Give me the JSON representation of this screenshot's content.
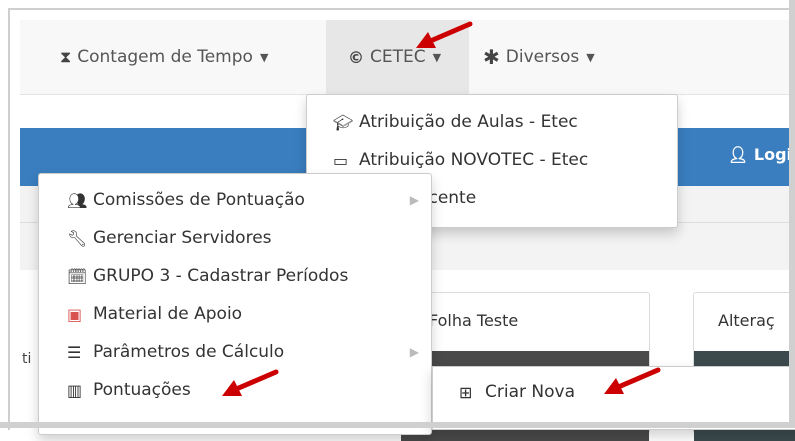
{
  "navbar": {
    "items": [
      {
        "label": "Contagem de Tempo",
        "icon": "hourglass-icon"
      },
      {
        "label": "CETEC",
        "icon": "copyright-icon"
      },
      {
        "label": "Diversos",
        "icon": "asterisk-icon"
      }
    ],
    "login_label": "Logi"
  },
  "cetec_menu": {
    "items": [
      {
        "label": "Atribuição de Aulas - Etec",
        "icon": "graduation-cap-icon"
      },
      {
        "label": "Atribuição NOVOTEC - Etec",
        "icon": "presentation-icon"
      },
      {
        "label": "ação Docente"
      }
    ]
  },
  "left_menu": {
    "items": [
      {
        "label": "Comissões de Pontuação",
        "icon": "users-icon",
        "submenu": true
      },
      {
        "label": "Gerenciar Servidores",
        "icon": "wrench-icon"
      },
      {
        "label": "GRUPO 3 - Cadastrar Períodos",
        "icon": "calendar-icon"
      },
      {
        "label": "Material de Apoio",
        "icon": "pdf-file-icon"
      },
      {
        "label": "Parâmetros de Cálculo",
        "icon": "list-ol-icon",
        "submenu": true
      },
      {
        "label": "Pontuações",
        "icon": "bar-chart-icon"
      }
    ]
  },
  "submenu": {
    "items": [
      {
        "label": "Criar Nova",
        "icon": "plus-square-icon"
      }
    ]
  },
  "cards": [
    {
      "title": "Folha Teste"
    },
    {
      "title": "Alteraç"
    }
  ],
  "side_text": "ti",
  "colors": {
    "primary": "#3a7ebf",
    "arrow": "#cc0000",
    "navbar_bg": "#f8f8f8"
  }
}
